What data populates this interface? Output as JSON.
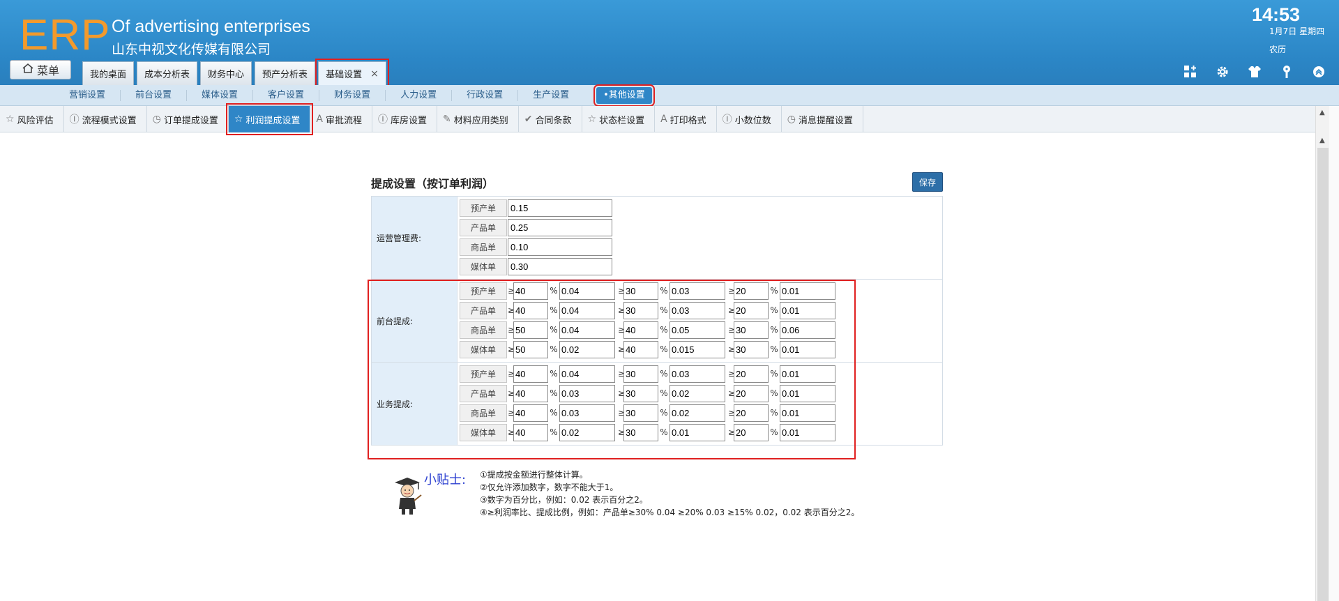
{
  "header": {
    "logo": "ERP",
    "subtitle_en": "Of advertising enterprises",
    "subtitle_cn": "山东中视文化传媒有限公司",
    "time": "14:53",
    "date": "1月7日 星期四",
    "lunar": "农历",
    "menu_label": "菜单"
  },
  "top_tabs": [
    {
      "label": "我的桌面"
    },
    {
      "label": "成本分析表"
    },
    {
      "label": "财务中心"
    },
    {
      "label": "预产分析表"
    },
    {
      "label": "基础设置"
    }
  ],
  "nav2": [
    {
      "label": "营销设置"
    },
    {
      "label": "前台设置"
    },
    {
      "label": "媒体设置"
    },
    {
      "label": "客户设置"
    },
    {
      "label": "财务设置"
    },
    {
      "label": "人力设置"
    },
    {
      "label": "行政设置"
    },
    {
      "label": "生产设置"
    },
    {
      "label": "•其他设置"
    }
  ],
  "nav3": [
    {
      "label": "风险评估",
      "icon": "☆"
    },
    {
      "label": "流程模式设置",
      "icon": "Ⓘ"
    },
    {
      "label": "订单提成设置",
      "icon": "◷"
    },
    {
      "label": "利润提成设置",
      "icon": "☆"
    },
    {
      "label": "审批流程",
      "icon": "A"
    },
    {
      "label": "库房设置",
      "icon": "Ⓘ"
    },
    {
      "label": "材料应用类别",
      "icon": "✎"
    },
    {
      "label": "合同条款",
      "icon": "✔"
    },
    {
      "label": "状态栏设置",
      "icon": "☆"
    },
    {
      "label": "打印格式",
      "icon": "A"
    },
    {
      "label": "小数位数",
      "icon": "Ⓘ"
    },
    {
      "label": "消息提醒设置",
      "icon": "◷"
    }
  ],
  "panel": {
    "title": "提成设置（按订单利润）",
    "save_label": "保存",
    "ge_symbol": "≥",
    "pct_symbol": "%",
    "operation": {
      "label": "运营管理费:",
      "rows": [
        {
          "kind": "预产单",
          "value": "0.15"
        },
        {
          "kind": "产品单",
          "value": "0.25"
        },
        {
          "kind": "商品单",
          "value": "0.10"
        },
        {
          "kind": "媒体单",
          "value": "0.30"
        }
      ]
    },
    "front": {
      "label": "前台提成:",
      "rows": [
        {
          "kind": "预产单",
          "t1": "40",
          "r1": "0.04",
          "t2": "30",
          "r2": "0.03",
          "t3": "20",
          "r3": "0.01"
        },
        {
          "kind": "产品单",
          "t1": "40",
          "r1": "0.04",
          "t2": "30",
          "r2": "0.03",
          "t3": "20",
          "r3": "0.01"
        },
        {
          "kind": "商品单",
          "t1": "50",
          "r1": "0.04",
          "t2": "40",
          "r2": "0.05",
          "t3": "30",
          "r3": "0.06"
        },
        {
          "kind": "媒体单",
          "t1": "50",
          "r1": "0.02",
          "t2": "40",
          "r2": "0.015",
          "t3": "30",
          "r3": "0.01"
        }
      ]
    },
    "business": {
      "label": "业务提成:",
      "rows": [
        {
          "kind": "预产单",
          "t1": "40",
          "r1": "0.04",
          "t2": "30",
          "r2": "0.03",
          "t3": "20",
          "r3": "0.01"
        },
        {
          "kind": "产品单",
          "t1": "40",
          "r1": "0.03",
          "t2": "30",
          "r2": "0.02",
          "t3": "20",
          "r3": "0.01"
        },
        {
          "kind": "商品单",
          "t1": "40",
          "r1": "0.03",
          "t2": "30",
          "r2": "0.02",
          "t3": "20",
          "r3": "0.01"
        },
        {
          "kind": "媒体单",
          "t1": "40",
          "r1": "0.02",
          "t2": "30",
          "r2": "0.01",
          "t3": "20",
          "r3": "0.01"
        }
      ]
    }
  },
  "tips": {
    "label": "小贴士:",
    "lines": [
      "①提成按金额进行整体计算。",
      "②仅允许添加数字，数字不能大于1。",
      "③数字为百分比，例如：0.02 表示百分之2。",
      "④≥利润率比、提成比例，例如：产品单≥30% 0.04 ≥20% 0.03 ≥15% 0.02，0.02 表示百分之2。"
    ]
  },
  "colors": {
    "header_blue": "#2b86c6",
    "logo_orange": "#f39a2c",
    "active_blue": "#2f86c7",
    "highlight_red": "#e02020"
  }
}
